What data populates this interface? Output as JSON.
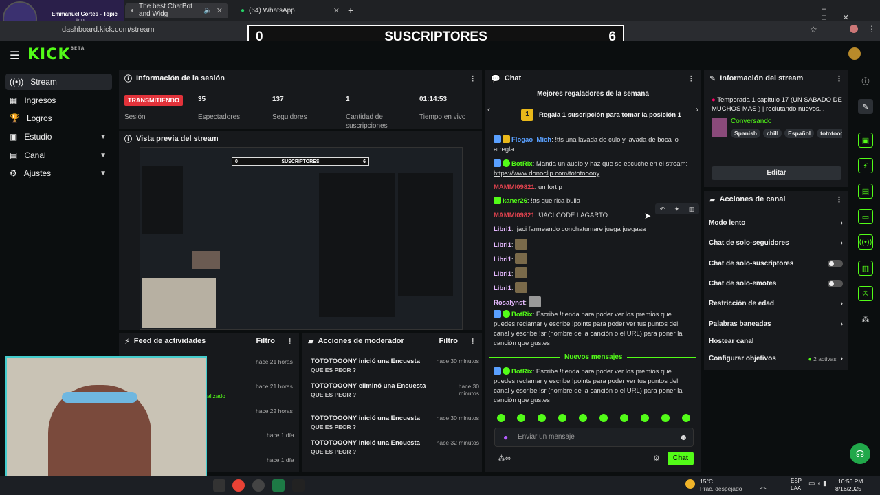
{
  "browser": {
    "tabs": [
      {
        "label": "The best ChatBot and Widg"
      },
      {
        "label": "(64) WhatsApp"
      }
    ],
    "url": "dashboard.kick.com/stream",
    "music_title": "Emmanuel Cortes - Topic",
    "music_sub": "Amor"
  },
  "overlay": {
    "left_count": "0",
    "title": "SUSCRIPTORES",
    "right_count": "6"
  },
  "brand": {
    "logo": "KICK",
    "beta": "BETA"
  },
  "sidebar": {
    "items": [
      {
        "label": "Stream"
      },
      {
        "label": "Ingresos"
      },
      {
        "label": "Logros"
      },
      {
        "label": "Estudio"
      },
      {
        "label": "Canal"
      },
      {
        "label": "Ajustes"
      }
    ]
  },
  "session": {
    "title": "Información de la sesión",
    "status": "TRANSMITIENDO",
    "status_label": "Sesión",
    "stats": [
      {
        "value": "35",
        "label": "Espectadores"
      },
      {
        "value": "137",
        "label": "Seguidores"
      },
      {
        "value": "1",
        "label": "Cantidad de suscripciones"
      },
      {
        "value": "01:14:53",
        "label": "Tiempo en vivo"
      }
    ]
  },
  "preview": {
    "title": "Vista previa del stream",
    "inner_label": "SUSCRIPTORES",
    "inner_left": "0",
    "inner_right": "6"
  },
  "feed": {
    "title": "Feed de actividades",
    "filter": "Filtro",
    "times": [
      "hace 21 horas",
      "hace 21 horas",
      "hace 22 horas",
      "hace 1 día",
      "hace 1 día"
    ],
    "partial": "alizado"
  },
  "mod": {
    "title": "Acciones de moderador",
    "filter": "Filtro",
    "rows": [
      {
        "user": "TOTOTOOONY",
        "action": "inició una Encuesta",
        "time": "hace 30 minutos",
        "q": "QUE ES PEOR ?"
      },
      {
        "user": "TOTOTOOONY",
        "action": "eliminó una Encuesta",
        "time": "hace 30 minutos",
        "q": "QUE ES PEOR ?"
      },
      {
        "user": "TOTOTOOONY",
        "action": "inició una Encuesta",
        "time": "hace 30 minutos",
        "q": "QUE ES PEOR ?"
      },
      {
        "user": "TOTOTOOONY",
        "action": "inició una Encuesta",
        "time": "hace 32 minutos",
        "q": "QUE ES PEOR ?"
      }
    ]
  },
  "chat": {
    "title": "Chat",
    "top_gifters": "Mejores regaladores de la semana",
    "gift_rank": "1",
    "gift_prompt": "Regala 1 suscripción para tomar la posición 1",
    "messages": [
      {
        "user": "Flogao_Mich",
        "text": "!tts una lavada de culo y lavada de boca lo arregla"
      },
      {
        "user": "BotRix",
        "text": "Manda un audio y haz que se escuche en el stream:",
        "link": "https://www.donoclip.com/tototooony"
      },
      {
        "user": "MAMMI09821",
        "text": "un fort p"
      },
      {
        "user": "kaner26",
        "text": "!tts que rica bulla"
      },
      {
        "user": "MAMMI09821",
        "text": "!JACI CODE LAGARTO"
      },
      {
        "user": "Libri1",
        "text": "!jaci farmeando conchatumare juega juegaaa"
      },
      {
        "user": "Libri1",
        "text": ""
      },
      {
        "user": "Libri1",
        "text": ""
      },
      {
        "user": "Libri1",
        "text": ""
      },
      {
        "user": "Libri1",
        "text": ""
      },
      {
        "user": "Rosalynst",
        "text": ""
      },
      {
        "user": "BotRix",
        "text": "Escribe !tienda para poder ver los premios que puedes reclamar y escribe !points para poder ver tus puntos del canal y escribe !sr (nombre de la canción o el URL) para poner la canción que gustes"
      }
    ],
    "new_messages": "Nuevos mensajes",
    "last": {
      "user": "BotRix",
      "text": "Escribe !tienda para poder ver los premios que puedes reclamar y escribe !points para poder ver tus puntos del canal y escribe !sr (nombre de la canción o el URL) para poner la canción que gustes"
    },
    "input_placeholder": "Enviar un mensaje",
    "send": "Chat"
  },
  "streaminfo": {
    "title": "Información del stream",
    "stream_title": "Temporada 1 capitulo 17 (UN SABADO DE MUCHOS MAS ) | reclutando nuevos...",
    "category": "Conversando",
    "tags": [
      "Spanish",
      "chill",
      "Español",
      "tototooo"
    ],
    "edit": "Editar"
  },
  "actions": {
    "title": "Acciones de canal",
    "items": [
      {
        "label": "Modo lento",
        "kind": "chev"
      },
      {
        "label": "Chat de solo-seguidores",
        "kind": "chev"
      },
      {
        "label": "Chat de solo-suscriptores",
        "kind": "toggle"
      },
      {
        "label": "Chat de solo-emotes",
        "kind": "toggle"
      },
      {
        "label": "Restricción de edad",
        "kind": "chev"
      },
      {
        "label": "Palabras baneadas",
        "kind": "chev"
      },
      {
        "label": "Hostear canal",
        "kind": "none"
      },
      {
        "label": "Configurar objetivos",
        "kind": "chev",
        "badge": "2 activas"
      }
    ]
  },
  "taskbar": {
    "temp": "15°C",
    "weather": "Prac. despejado",
    "lang1": "ESP",
    "lang2": "LAA",
    "time": "10:56 PM",
    "date": "8/16/2025"
  }
}
